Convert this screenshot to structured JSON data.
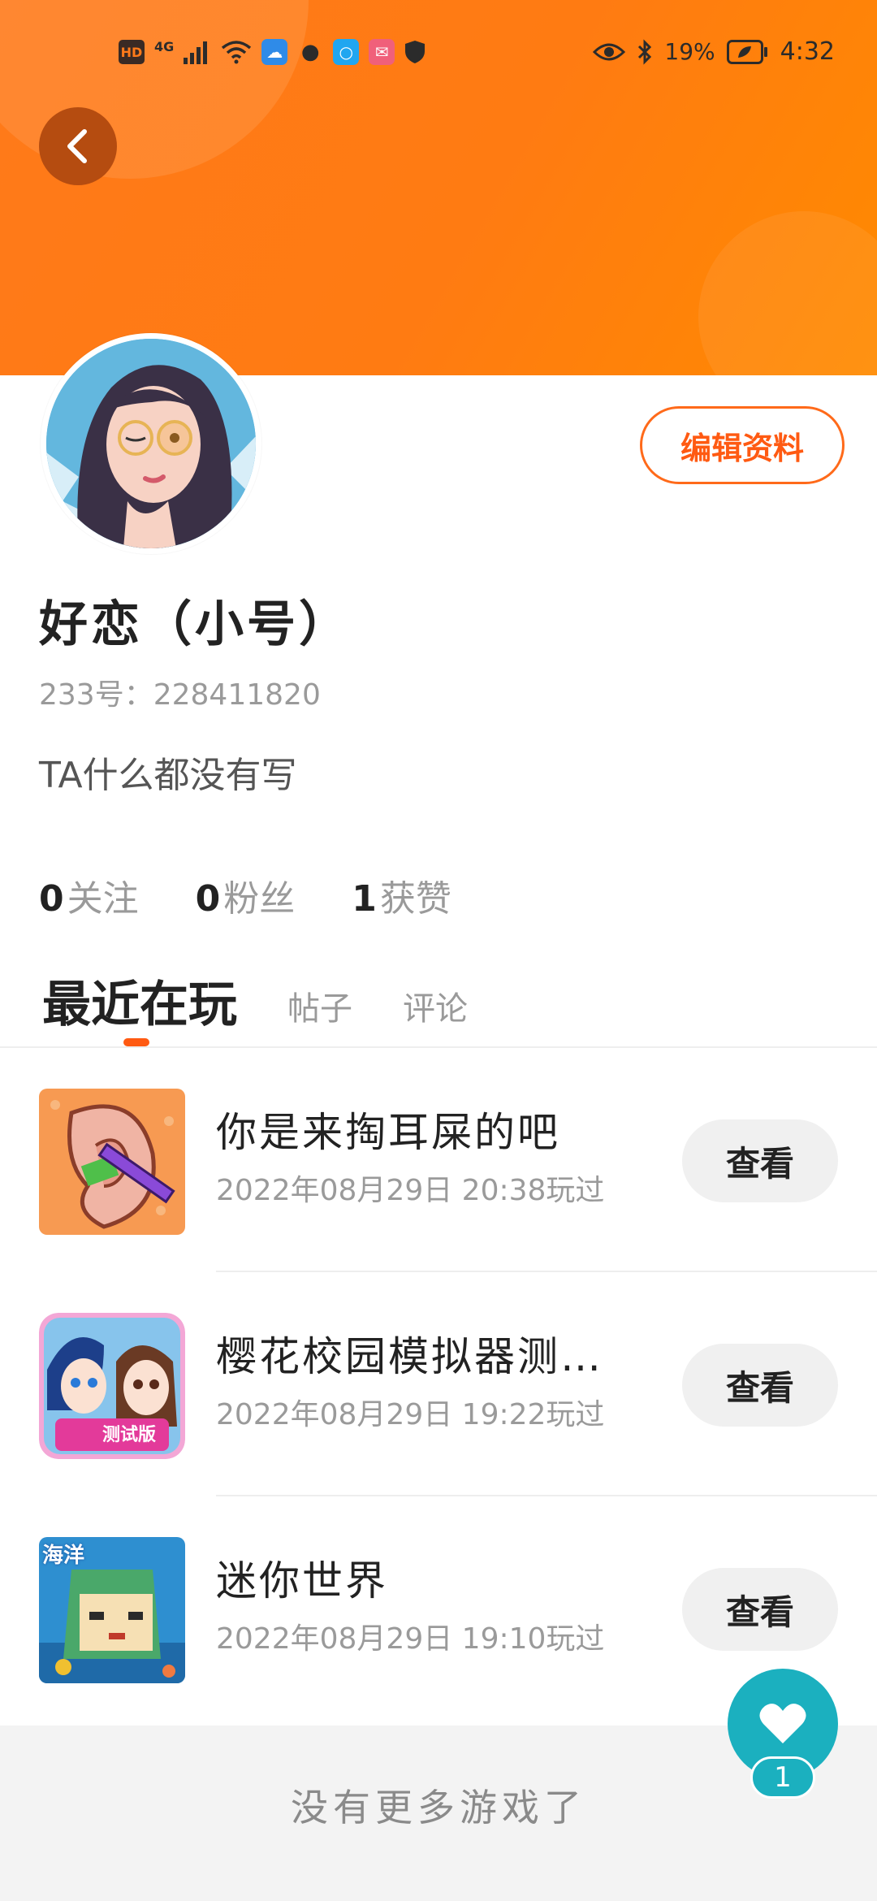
{
  "status_bar": {
    "left_badges": [
      "HD",
      "4G"
    ],
    "battery": "19%",
    "time": "4:32"
  },
  "profile": {
    "name": "好恋（小号）",
    "uid": "233号：228411820",
    "bio": "TA什么都没有写",
    "edit_label": "编辑资料",
    "stats": [
      {
        "count": "0",
        "label": "关注"
      },
      {
        "count": "0",
        "label": "粉丝"
      },
      {
        "count": "1",
        "label": "获赞"
      }
    ]
  },
  "tabs": [
    "最近在玩",
    "帖子",
    "评论"
  ],
  "games": [
    {
      "title": "你是来掏耳屎的吧",
      "time": "2022年08月29日 20:38玩过",
      "button": "查看"
    },
    {
      "title": "樱花校园模拟器测…",
      "time": "2022年08月29日 19:22玩过",
      "button": "查看"
    },
    {
      "title": "迷你世界",
      "time": "2022年08月29日 19:10玩过",
      "button": "查看"
    }
  ],
  "icon_badges": {
    "game2": "测试版",
    "game3": "海洋"
  },
  "footer": {
    "text": "没有更多游戏了"
  },
  "like": {
    "count": "1"
  },
  "colors": {
    "accent": "#ff6a1a",
    "teal": "#1bb0bf"
  }
}
